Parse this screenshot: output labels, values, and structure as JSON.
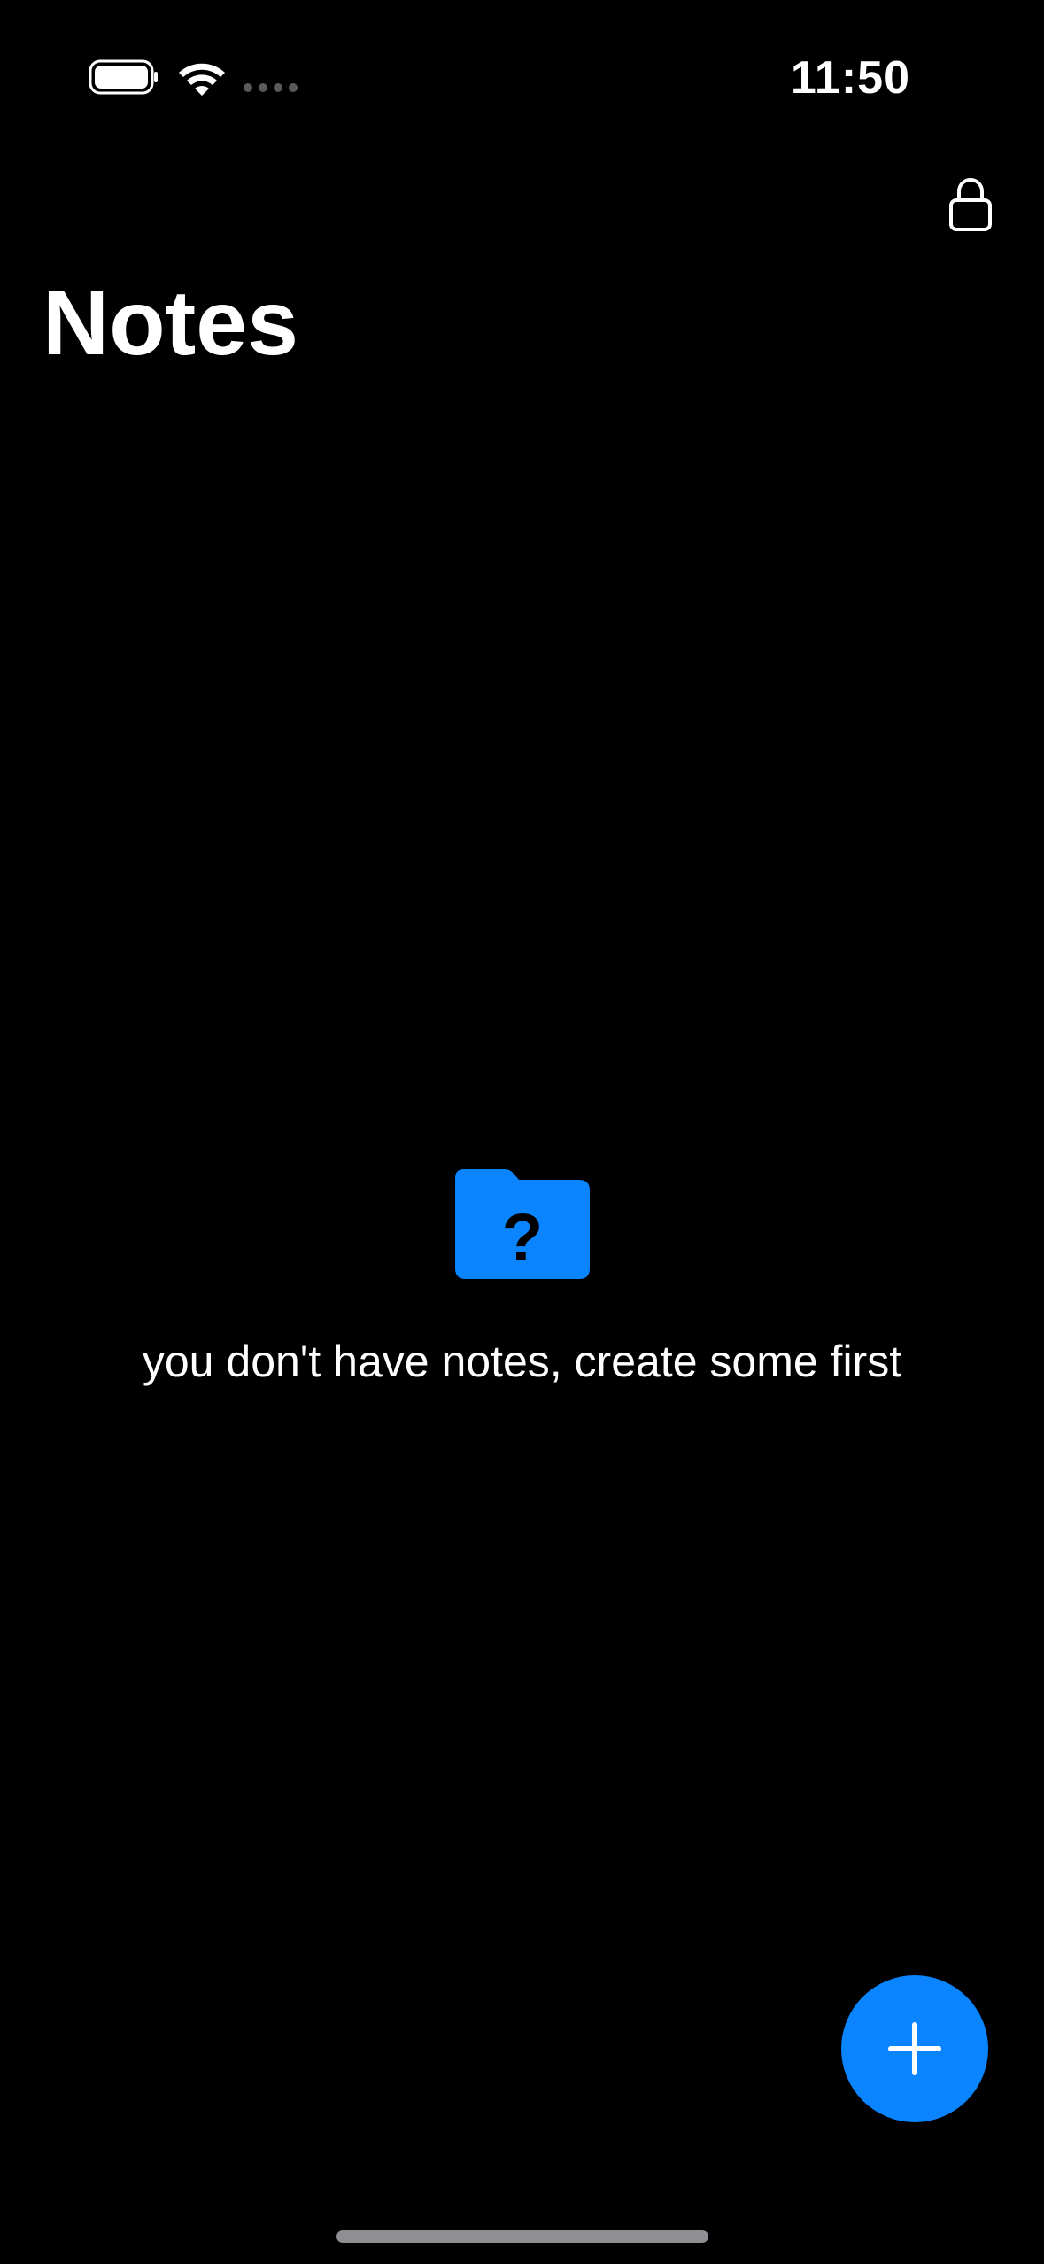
{
  "status_bar": {
    "time": "11:50",
    "battery_icon": "battery-icon",
    "wifi_icon": "wifi-icon",
    "cellular_icon": "cellular-dots-icon"
  },
  "header": {
    "title": "Notes",
    "lock_icon": "lock-icon"
  },
  "empty_state": {
    "icon": "folder-question-icon",
    "message": "you don't have notes, create some first"
  },
  "fab": {
    "icon": "plus-icon"
  },
  "colors": {
    "background": "#000000",
    "accent": "#0a84ff",
    "text": "#ffffff"
  }
}
